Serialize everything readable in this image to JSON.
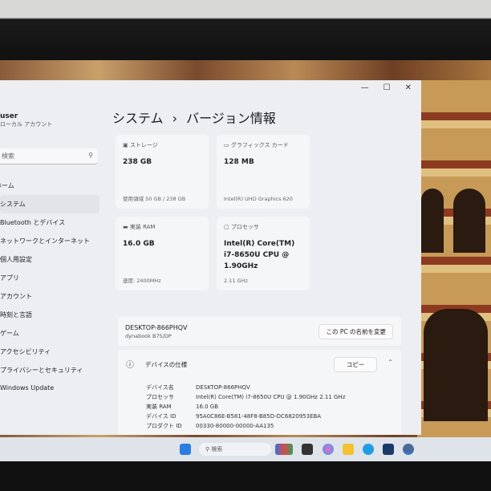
{
  "window": {
    "user": "user",
    "account": "ローカル アカウント",
    "search_placeholder": "検索",
    "controls": [
      "—",
      "☐",
      "✕"
    ]
  },
  "nav": [
    "ホーム",
    "システム",
    "Bluetooth とデバイス",
    "ネットワークとインターネット",
    "個人用設定",
    "アプリ",
    "アカウント",
    "時刻と言語",
    "ゲーム",
    "アクセシビリティ",
    "プライバシーとセキュリティ",
    "Windows Update"
  ],
  "breadcrumb": {
    "parent": "システム",
    "sep": "›",
    "current": "バージョン情報"
  },
  "cards": [
    {
      "label": "ストレージ",
      "value": "238 GB",
      "sub": "使用領域 50 GB / 238 GB"
    },
    {
      "label": "グラフィックス カード",
      "value": "128 MB",
      "sub": "Intel(R) UHD Graphics 620"
    },
    {
      "label": "実装 RAM",
      "value": "16.0 GB",
      "sub": "速度: 2400MHz"
    },
    {
      "label": "プロセッサ",
      "value": "Intel(R) Core(TM) i7-8650U CPU @ 1.90GHz",
      "sub": "2.11 GHz"
    }
  ],
  "device": {
    "name": "DESKTOP-866PHQV",
    "model": "dynabook B75/DP",
    "rename": "この PC の名前を変更"
  },
  "specs": {
    "title": "デバイスの仕様",
    "copy": "コピー",
    "rows": [
      {
        "k": "デバイス名",
        "v": "DESKTOP-866PHQV"
      },
      {
        "k": "プロセッサ",
        "v": "Intel(R) Core(TM) i7-8650U CPU @ 1.90GHz   2.11 GHz"
      },
      {
        "k": "実装 RAM",
        "v": "16.0 GB"
      },
      {
        "k": "デバイス ID",
        "v": "95A0C86E-B581-48F8-B85D-DC6820953EBA"
      },
      {
        "k": "プロダクト ID",
        "v": "00330-80000-00000-AA135"
      }
    ]
  },
  "taskbar": {
    "search": "検索"
  }
}
